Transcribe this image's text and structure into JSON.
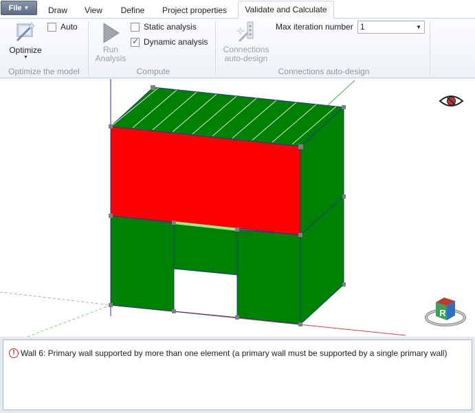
{
  "menu": {
    "file_label": "File",
    "tabs": [
      {
        "label": "Draw"
      },
      {
        "label": "View"
      },
      {
        "label": "Define"
      },
      {
        "label": "Project properties"
      },
      {
        "label": "Validate and Calculate"
      }
    ],
    "active_tab": "Validate and Calculate"
  },
  "ribbon": {
    "optimize_group": {
      "button_label": "Optimize",
      "auto_label": "Auto",
      "auto_checked": false,
      "group_label": "Optimize the model"
    },
    "compute_group": {
      "run_label_line1": "Run",
      "run_label_line2": "Analysis",
      "static_label": "Static analysis",
      "static_checked": false,
      "dynamic_label": "Dynamic analysis",
      "dynamic_checked": true,
      "group_label": "Compute"
    },
    "connections_group": {
      "button_label_line1": "Connections",
      "button_label_line2": "auto-design",
      "max_iter_label": "Max iteration number",
      "max_iter_value": "1",
      "group_label": "Connections auto-design"
    }
  },
  "viewport": {
    "colors": {
      "wall_green": "#008000",
      "wall_red": "#ff0000",
      "highlight_green": "#90ee90",
      "node_gray": "#808080"
    },
    "view_cube_label": "R"
  },
  "messages": [
    {
      "type": "warning",
      "text": "Wall 6: Primary wall supported by more than one element (a primary wall must be supported by a single primary wall)"
    }
  ]
}
